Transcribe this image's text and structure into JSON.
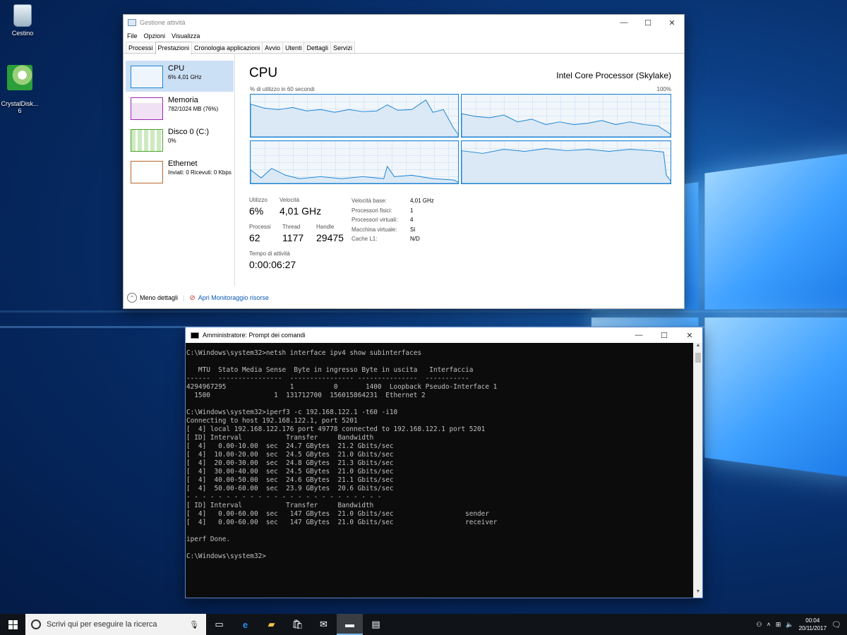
{
  "desktop": {
    "icons": [
      {
        "label": "Cestino",
        "icon": "recycle-bin-icon"
      },
      {
        "label": "CrystalDisk...\n6",
        "icon": "crystaldisk-icon"
      }
    ]
  },
  "task_manager": {
    "title": "Gestione attività",
    "menu": [
      "File",
      "Opzioni",
      "Visualizza"
    ],
    "tabs": [
      "Processi",
      "Prestazioni",
      "Cronologia applicazioni",
      "Avvio",
      "Utenti",
      "Dettagli",
      "Servizi"
    ],
    "active_tab": "Prestazioni",
    "sidebar": [
      {
        "name": "CPU",
        "sub": "6% 4,01 GHz",
        "color": "#1d84d2"
      },
      {
        "name": "Memoria",
        "sub": "782/1024 MB (76%)",
        "color": "#9a28b1"
      },
      {
        "name": "Disco 0 (C:)",
        "sub": "0%",
        "color": "#4da32a"
      },
      {
        "name": "Ethernet",
        "sub": "Inviati: 0 Ricevuti: 0 Kbps",
        "color": "#b5682a"
      }
    ],
    "cpu": {
      "title": "CPU",
      "model": "Intel Core Processor (Skylake)",
      "graph_label": "% di utilizzo in 60 secondi",
      "graph_max": "100%",
      "stats": {
        "utilizzo_label": "Utilizzo",
        "utilizzo": "6%",
        "velocita_label": "Velocità",
        "velocita": "4,01 GHz",
        "processi_label": "Processi",
        "processi": "62",
        "thread_label": "Thread",
        "thread": "1177",
        "handle_label": "Handle",
        "handle": "29475",
        "uptime_label": "Tempo di attività",
        "uptime": "0:00:06:27"
      },
      "details": [
        {
          "k": "Velocità base:",
          "v": "4,01 GHz"
        },
        {
          "k": "Processori fisici:",
          "v": "1"
        },
        {
          "k": "Processori virtuali:",
          "v": "4"
        },
        {
          "k": "Macchina virtuale:",
          "v": "Sì"
        },
        {
          "k": "Cache L1:",
          "v": "N/D"
        }
      ]
    },
    "footer": {
      "less_details": "Meno dettagli",
      "open_monitor": "Apri Monitoraggio risorse"
    }
  },
  "cmd": {
    "title": "Amministratore: Prompt dei comandi",
    "lines": [
      "C:\\Windows\\system32>netsh interface ipv4 show subinterfaces",
      "",
      "   MTU  Stato Media Sense  Byte in ingresso Byte in uscita   Interfaccia",
      "------  ----------------  ---------------- ---------------  -----------",
      "4294967295                1          0       1400  Loopback Pseudo-Interface 1",
      "  1500                1  131712700  156015864231  Ethernet 2",
      "",
      "C:\\Windows\\system32>iperf3 -c 192.168.122.1 -t60 -i10",
      "Connecting to host 192.168.122.1, port 5201",
      "[  4] local 192.168.122.176 port 49778 connected to 192.168.122.1 port 5201",
      "[ ID] Interval           Transfer     Bandwidth",
      "[  4]   0.00-10.00  sec  24.7 GBytes  21.2 Gbits/sec",
      "[  4]  10.00-20.00  sec  24.5 GBytes  21.0 Gbits/sec",
      "[  4]  20.00-30.00  sec  24.8 GBytes  21.3 Gbits/sec",
      "[  4]  30.00-40.00  sec  24.5 GBytes  21.0 Gbits/sec",
      "[  4]  40.00-50.00  sec  24.6 GBytes  21.1 Gbits/sec",
      "[  4]  50.00-60.00  sec  23.9 GBytes  20.6 Gbits/sec",
      "- - - - - - - - - - - - - - - - - - - - - - - - -",
      "[ ID] Interval           Transfer     Bandwidth",
      "[  4]   0.00-60.00  sec   147 GBytes  21.0 Gbits/sec                  sender",
      "[  4]   0.00-60.00  sec   147 GBytes  21.0 Gbits/sec                  receiver",
      "",
      "iperf Done.",
      "",
      "C:\\Windows\\system32>"
    ]
  },
  "taskbar": {
    "search_placeholder": "Scrivi qui per eseguire la ricerca",
    "clock_time": "00:04",
    "clock_date": "20/11/2017"
  }
}
